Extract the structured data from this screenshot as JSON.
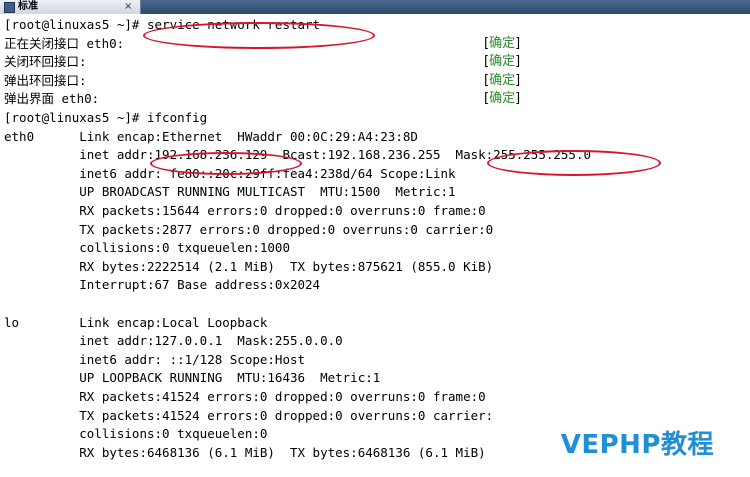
{
  "tab": {
    "label": "标准",
    "close": "×"
  },
  "terminal": {
    "lines": [
      "[root@linuxas5 ~]# service network restart",
      "正在关闭接口 eth0:",
      "关闭环回接口:",
      "弹出环回接口:",
      "弹出界面 eth0:",
      "[root@linuxas5 ~]# ifconfig",
      "eth0      Link encap:Ethernet  HWaddr 00:0C:29:A4:23:8D",
      "          inet addr:192.168.236.129  Bcast:192.168.236.255  Mask:255.255.255.0",
      "          inet6 addr: fe80::20c:29ff:fea4:238d/64 Scope:Link",
      "          UP BROADCAST RUNNING MULTICAST  MTU:1500  Metric:1",
      "          RX packets:15644 errors:0 dropped:0 overruns:0 frame:0",
      "          TX packets:2877 errors:0 dropped:0 overruns:0 carrier:0",
      "          collisions:0 txqueuelen:1000",
      "          RX bytes:2222514 (2.1 MiB)  TX bytes:875621 (855.0 KiB)",
      "          Interrupt:67 Base address:0x2024",
      "",
      "lo        Link encap:Local Loopback",
      "          inet addr:127.0.0.1  Mask:255.0.0.0",
      "          inet6 addr: ::1/128 Scope:Host",
      "          UP LOOPBACK RUNNING  MTU:16436  Metric:1",
      "          RX packets:41524 errors:0 dropped:0 overruns:0 frame:0",
      "          TX packets:41524 errors:0 dropped:0 overruns:0 carrier:",
      "          collisions:0 txqueuelen:0",
      "          RX bytes:6468136 (6.1 MiB)  TX bytes:6468136 (6.1 MiB)"
    ],
    "status": [
      {
        "open": "[",
        "ok": "确定",
        "close": "]"
      },
      {
        "open": "[",
        "ok": "确定",
        "close": "]"
      },
      {
        "open": "[",
        "ok": "确定",
        "close": "]"
      },
      {
        "open": "[",
        "ok": "确定",
        "close": "]"
      }
    ]
  },
  "watermark": "VEPHP教程",
  "colors": {
    "annotation": "#d9142b",
    "ok": "#2c8c2c",
    "watermark": "#1f8fd6",
    "tabbar": "#3a5a7e"
  }
}
